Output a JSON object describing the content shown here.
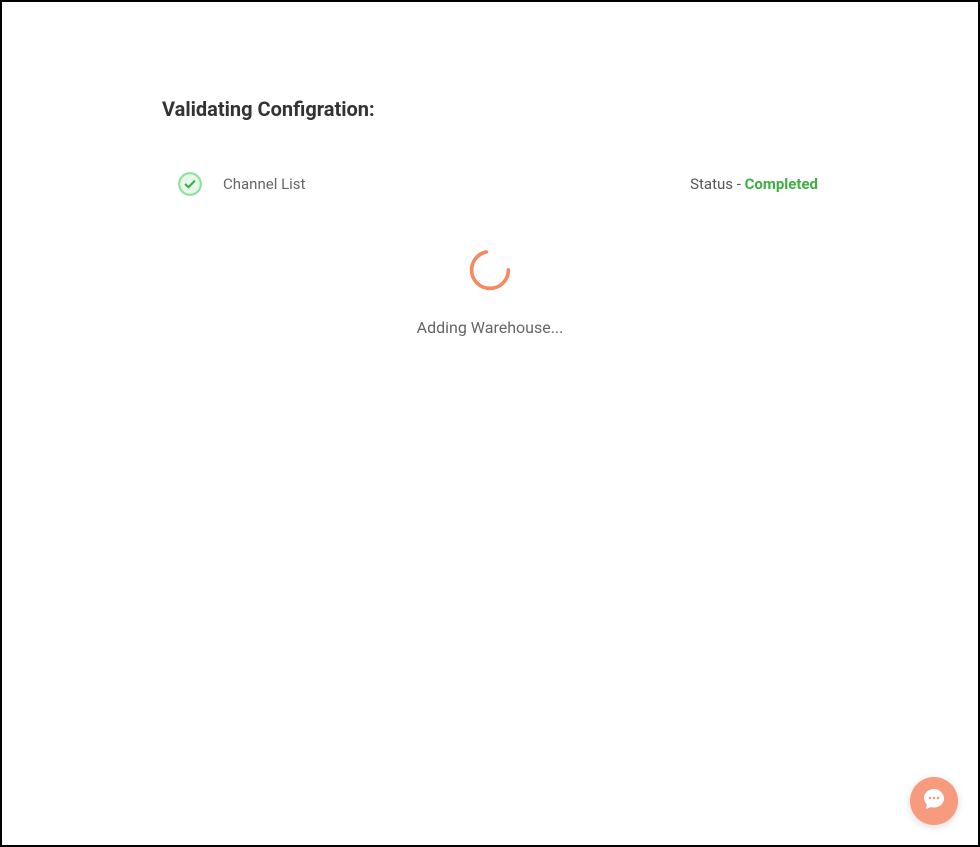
{
  "title": "Validating Configration:",
  "validation_items": [
    {
      "label": "Channel List",
      "status_prefix": "Status - ",
      "status_value": "Completed"
    }
  ],
  "loading": {
    "text": "Adding Warehouse..."
  },
  "colors": {
    "success": "#3cb043",
    "spinner": "#f38b5f",
    "chat_button": "#f89a7d"
  }
}
